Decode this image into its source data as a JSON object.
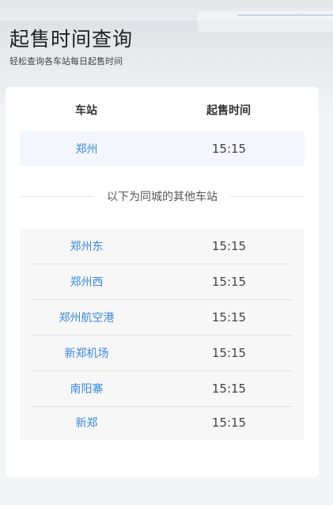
{
  "header": {
    "title": "起售时间查询",
    "subtitle": "轻松查询各车站每日起售时间"
  },
  "table": {
    "col_station": "车站",
    "col_time": "起售时间",
    "primary": {
      "station": "郑州",
      "time": "15:15"
    },
    "divider": "以下为同城的其他车站",
    "others": [
      {
        "station": "郑州东",
        "time": "15:15"
      },
      {
        "station": "郑州西",
        "time": "15:15"
      },
      {
        "station": "郑州航空港",
        "time": "15:15"
      },
      {
        "station": "新郑机场",
        "time": "15:15"
      },
      {
        "station": "南阳寨",
        "time": "15:15"
      },
      {
        "station": "新郑",
        "time": "15:15"
      }
    ]
  },
  "colors": {
    "station_link": "#3b8ad9",
    "primary_row_bg": "#f3f6fd"
  }
}
